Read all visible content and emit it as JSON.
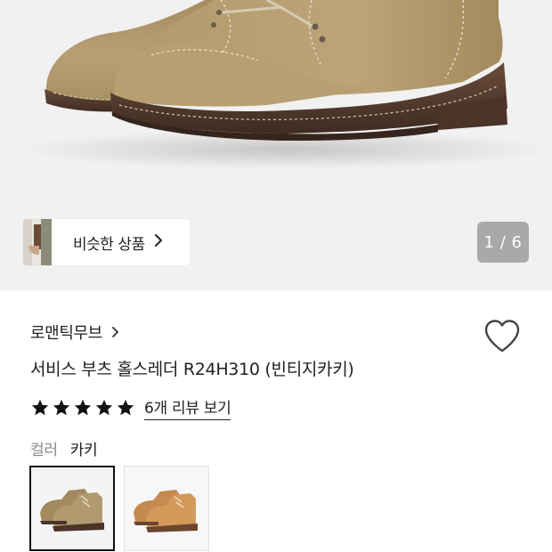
{
  "gallery": {
    "similar_label": "비슷한 상품",
    "counter": "1 / 6"
  },
  "product": {
    "brand": "로맨틱무브",
    "title": "서비스 부츠 홀스레더 R24H310 (빈티지카키)",
    "rating": 5,
    "rating_max": 5,
    "review_link": "6개 리뷰 보기",
    "color_label": "컬러",
    "color_value": "카키",
    "swatches": [
      {
        "name": "vintage-khaki",
        "selected": true
      },
      {
        "name": "tan-brown",
        "selected": false
      }
    ]
  },
  "colors": {
    "suede_khaki": "#b39a6e",
    "sole_brown": "#5a4032",
    "counter_bg": "#a9a9a9",
    "gallery_bg": "#f1f1f1"
  }
}
